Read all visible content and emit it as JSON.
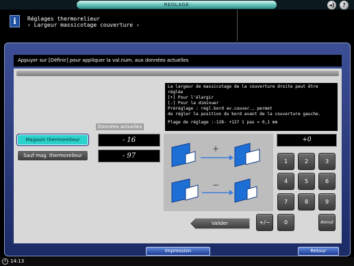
{
  "top": {
    "title": "REGLAGE"
  },
  "header": {
    "line1": "Réglages thermorelieur",
    "line2": "‹ Largeur massicotage couverture ›"
  },
  "message": "Appuyer sur [Définir] pour appliquer la val.num. aux données actuelles",
  "current_data_label": "Données actuelles",
  "magazins": [
    {
      "label": "Magasin thermorelieur",
      "value": "- 16",
      "active": true
    },
    {
      "label": "Sauf mag. thermorelieur",
      "value": "- 97",
      "active": false
    }
  ],
  "description": [
    "La largeur de massicotage de la couverture droite peut être",
    "réglée",
    "[+] Pour l'élargir",
    "[-] Pour la diminuer",
    "Préréglage : régl.bord av.couver., permet",
    "de régler la position du bord avant de la couverture gauche.",
    "",
    "Plage de réglage :-128- +127 1 pas = 0,1 mm"
  ],
  "illustration": {
    "plus": "+",
    "minus": "−"
  },
  "keypad": {
    "display": "+0",
    "keys": [
      "1",
      "2",
      "3",
      "4",
      "5",
      "6",
      "7",
      "8",
      "9"
    ],
    "plusminus": "+/−",
    "zero": "0",
    "cancel": "Annul"
  },
  "buttons": {
    "valider": "Valider",
    "impression": "Impression",
    "retour": "Retour"
  },
  "status": {
    "time": "14:13"
  },
  "colors": {
    "panel": "#2a3c80",
    "active_button": "#2bd2cc",
    "accent": "#1d6fd6"
  }
}
